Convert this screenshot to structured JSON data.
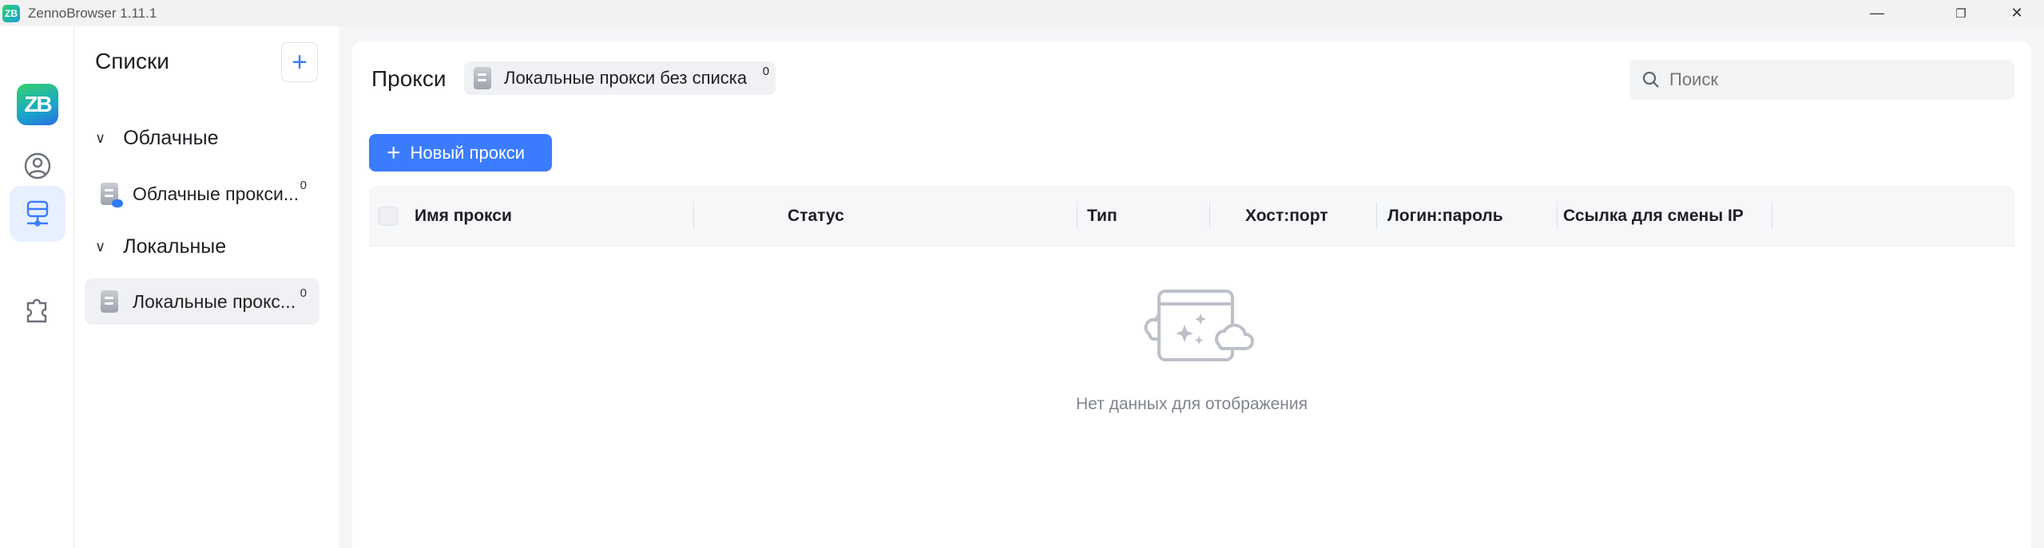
{
  "window": {
    "title": "ZennoBrowser 1.11.1",
    "logo": "ZB"
  },
  "rail": {
    "logo": "ZB"
  },
  "sidebar": {
    "title": "Списки",
    "groups": [
      {
        "label": "Облачные",
        "items": [
          {
            "label": "Облачные прокси...",
            "count": "0"
          }
        ]
      },
      {
        "label": "Локальные",
        "items": [
          {
            "label": "Локальные прокс...",
            "count": "0"
          }
        ]
      }
    ]
  },
  "main": {
    "title": "Прокси",
    "chip": {
      "label": "Локальные прокси без списка",
      "count": "0"
    },
    "search": {
      "placeholder": "Поиск"
    },
    "new_button": "Новый прокси",
    "columns": [
      "Имя прокси",
      "Статус",
      "Тип",
      "Хост:порт",
      "Логин:пароль",
      "Ссылка для смены IP"
    ],
    "empty_text": "Нет данных для отображения"
  },
  "colors": {
    "accent": "#3b7cff"
  }
}
